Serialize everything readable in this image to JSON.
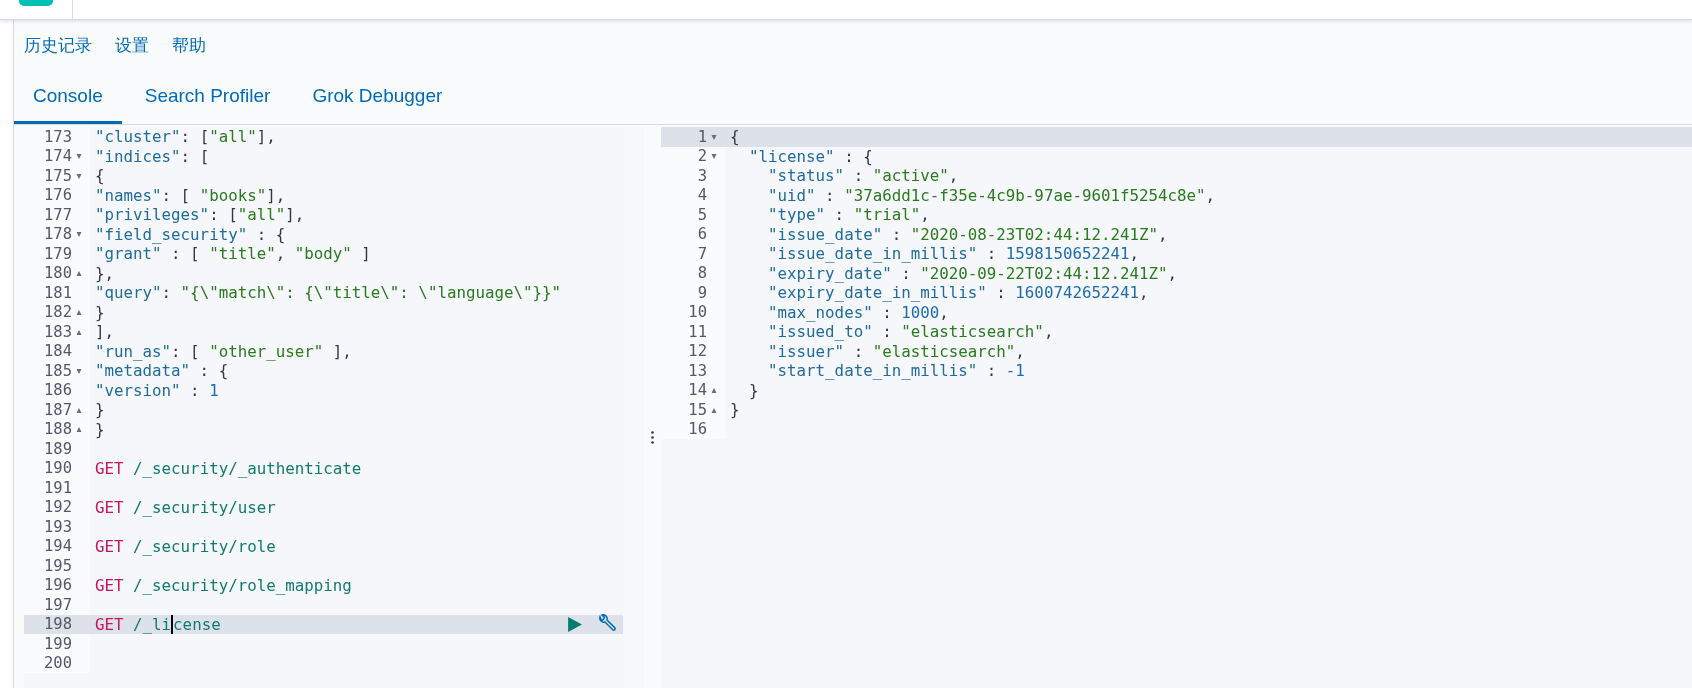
{
  "top_menu": [
    {
      "label": "历史记录"
    },
    {
      "label": "设置"
    },
    {
      "label": "帮助"
    }
  ],
  "tabs": [
    {
      "label": "Console",
      "selected": true
    },
    {
      "label": "Search Profiler",
      "selected": false
    },
    {
      "label": "Grok Debugger",
      "selected": false
    }
  ],
  "request_editor": {
    "lines": [
      {
        "number": "173",
        "selected": false,
        "tokens": [
          {
            "kind": "key",
            "text": "\"cluster\""
          },
          {
            "kind": "punct",
            "text": ": ["
          },
          {
            "kind": "string",
            "text": "\"all\""
          },
          {
            "kind": "punct",
            "text": "],"
          }
        ]
      },
      {
        "number": "174",
        "fold": "▾",
        "selected": false,
        "tokens": [
          {
            "kind": "key",
            "text": "\"indices\""
          },
          {
            "kind": "punct",
            "text": ": ["
          }
        ]
      },
      {
        "number": "175",
        "fold": "▾",
        "selected": false,
        "tokens": [
          {
            "kind": "punct",
            "text": "{"
          }
        ]
      },
      {
        "number": "176",
        "selected": false,
        "tokens": [
          {
            "kind": "key",
            "text": "\"names\""
          },
          {
            "kind": "punct",
            "text": ": [ "
          },
          {
            "kind": "string",
            "text": "\"books\""
          },
          {
            "kind": "punct",
            "text": "],"
          }
        ]
      },
      {
        "number": "177",
        "selected": false,
        "tokens": [
          {
            "kind": "key",
            "text": "\"privileges\""
          },
          {
            "kind": "punct",
            "text": ": ["
          },
          {
            "kind": "string",
            "text": "\"all\""
          },
          {
            "kind": "punct",
            "text": "],"
          }
        ]
      },
      {
        "number": "178",
        "fold": "▾",
        "selected": false,
        "tokens": [
          {
            "kind": "key",
            "text": "\"field_security\""
          },
          {
            "kind": "punct",
            "text": " : {"
          }
        ]
      },
      {
        "number": "179",
        "selected": false,
        "tokens": [
          {
            "kind": "key",
            "text": "\"grant\""
          },
          {
            "kind": "punct",
            "text": " : [ "
          },
          {
            "kind": "string",
            "text": "\"title\""
          },
          {
            "kind": "punct",
            "text": ", "
          },
          {
            "kind": "string",
            "text": "\"body\""
          },
          {
            "kind": "punct",
            "text": " ]"
          }
        ]
      },
      {
        "number": "180",
        "fold": "▴",
        "selected": false,
        "tokens": [
          {
            "kind": "punct",
            "text": "},"
          }
        ]
      },
      {
        "number": "181",
        "selected": false,
        "tokens": [
          {
            "kind": "key",
            "text": "\"query\""
          },
          {
            "kind": "punct",
            "text": ": "
          },
          {
            "kind": "string",
            "text": "\"{\\\"match\\\": {\\\"title\\\": \\\"language\\\"}}\""
          }
        ]
      },
      {
        "number": "182",
        "fold": "▴",
        "selected": false,
        "tokens": [
          {
            "kind": "punct",
            "text": "}"
          }
        ]
      },
      {
        "number": "183",
        "fold": "▴",
        "selected": false,
        "tokens": [
          {
            "kind": "punct",
            "text": "],"
          }
        ]
      },
      {
        "number": "184",
        "selected": false,
        "tokens": [
          {
            "kind": "key",
            "text": "\"run_as\""
          },
          {
            "kind": "punct",
            "text": ": [ "
          },
          {
            "kind": "string",
            "text": "\"other_user\""
          },
          {
            "kind": "punct",
            "text": " ],"
          }
        ]
      },
      {
        "number": "185",
        "fold": "▾",
        "selected": false,
        "tokens": [
          {
            "kind": "key",
            "text": "\"metadata\""
          },
          {
            "kind": "punct",
            "text": " : {"
          }
        ]
      },
      {
        "number": "186",
        "selected": false,
        "tokens": [
          {
            "kind": "key",
            "text": "\"version\""
          },
          {
            "kind": "punct",
            "text": " : "
          },
          {
            "kind": "number",
            "text": "1"
          }
        ]
      },
      {
        "number": "187",
        "fold": "▴",
        "selected": false,
        "tokens": [
          {
            "kind": "punct",
            "text": "}"
          }
        ]
      },
      {
        "number": "188",
        "fold": "▴",
        "selected": false,
        "tokens": [
          {
            "kind": "punct",
            "text": "}"
          }
        ]
      },
      {
        "number": "189",
        "selected": false
      },
      {
        "number": "190",
        "selected": false,
        "tokens": [
          {
            "kind": "method",
            "text": "GET"
          },
          {
            "kind": "url",
            "text": " /_security/_authenticate"
          }
        ]
      },
      {
        "number": "191",
        "selected": false
      },
      {
        "number": "192",
        "selected": false,
        "tokens": [
          {
            "kind": "method",
            "text": "GET"
          },
          {
            "kind": "url",
            "text": " /_security/user"
          }
        ]
      },
      {
        "number": "193",
        "selected": false
      },
      {
        "number": "194",
        "selected": false,
        "tokens": [
          {
            "kind": "method",
            "text": "GET"
          },
          {
            "kind": "url",
            "text": " /_security/role"
          }
        ]
      },
      {
        "number": "195",
        "selected": false
      },
      {
        "number": "196",
        "selected": false,
        "tokens": [
          {
            "kind": "method",
            "text": "GET"
          },
          {
            "kind": "url",
            "text": " /_security/role_mapping"
          }
        ]
      },
      {
        "number": "197",
        "selected": false
      },
      {
        "number": "198",
        "selected": true,
        "tokens": [
          {
            "kind": "method",
            "text": "GET"
          },
          {
            "kind": "url",
            "text": " /_li"
          },
          {
            "kind": "url",
            "text": "cense",
            "caret_before": true
          }
        ]
      },
      {
        "number": "199",
        "selected": false
      },
      {
        "number": "200",
        "selected": false
      }
    ]
  },
  "response_viewer": {
    "lines": [
      {
        "number": "1",
        "fold": "▾",
        "selected": true,
        "tokens": [
          {
            "kind": "punct",
            "text": "{"
          }
        ]
      },
      {
        "number": "2",
        "fold": "▾",
        "selected": false,
        "tokens": [
          {
            "kind": "key",
            "text": "  \"license\""
          },
          {
            "kind": "punct",
            "text": " : {"
          }
        ]
      },
      {
        "number": "3",
        "selected": false,
        "tokens": [
          {
            "kind": "key",
            "text": "    \"status\""
          },
          {
            "kind": "punct",
            "text": " : "
          },
          {
            "kind": "string",
            "text": "\"active\""
          },
          {
            "kind": "punct",
            "text": ","
          }
        ]
      },
      {
        "number": "4",
        "selected": false,
        "tokens": [
          {
            "kind": "key",
            "text": "    \"uid\""
          },
          {
            "kind": "punct",
            "text": " : "
          },
          {
            "kind": "string",
            "text": "\"37a6dd1c-f35e-4c9b-97ae-9601f5254c8e\""
          },
          {
            "kind": "punct",
            "text": ","
          }
        ]
      },
      {
        "number": "5",
        "selected": false,
        "tokens": [
          {
            "kind": "key",
            "text": "    \"type\""
          },
          {
            "kind": "punct",
            "text": " : "
          },
          {
            "kind": "string",
            "text": "\"trial\""
          },
          {
            "kind": "punct",
            "text": ","
          }
        ]
      },
      {
        "number": "6",
        "selected": false,
        "tokens": [
          {
            "kind": "key",
            "text": "    \"issue_date\""
          },
          {
            "kind": "punct",
            "text": " : "
          },
          {
            "kind": "string",
            "text": "\"2020-08-23T02:44:12.241Z\""
          },
          {
            "kind": "punct",
            "text": ","
          }
        ]
      },
      {
        "number": "7",
        "selected": false,
        "tokens": [
          {
            "kind": "key",
            "text": "    \"issue_date_in_millis\""
          },
          {
            "kind": "punct",
            "text": " : "
          },
          {
            "kind": "number",
            "text": "1598150652241"
          },
          {
            "kind": "punct",
            "text": ","
          }
        ]
      },
      {
        "number": "8",
        "selected": false,
        "tokens": [
          {
            "kind": "key",
            "text": "    \"expiry_date\""
          },
          {
            "kind": "punct",
            "text": " : "
          },
          {
            "kind": "string",
            "text": "\"2020-09-22T02:44:12.241Z\""
          },
          {
            "kind": "punct",
            "text": ","
          }
        ]
      },
      {
        "number": "9",
        "selected": false,
        "tokens": [
          {
            "kind": "key",
            "text": "    \"expiry_date_in_millis\""
          },
          {
            "kind": "punct",
            "text": " : "
          },
          {
            "kind": "number",
            "text": "1600742652241"
          },
          {
            "kind": "punct",
            "text": ","
          }
        ]
      },
      {
        "number": "10",
        "selected": false,
        "tokens": [
          {
            "kind": "key",
            "text": "    \"max_nodes\""
          },
          {
            "kind": "punct",
            "text": " : "
          },
          {
            "kind": "number",
            "text": "1000"
          },
          {
            "kind": "punct",
            "text": ","
          }
        ]
      },
      {
        "number": "11",
        "selected": false,
        "tokens": [
          {
            "kind": "key",
            "text": "    \"issued_to\""
          },
          {
            "kind": "punct",
            "text": " : "
          },
          {
            "kind": "string",
            "text": "\"elasticsearch\""
          },
          {
            "kind": "punct",
            "text": ","
          }
        ]
      },
      {
        "number": "12",
        "selected": false,
        "tokens": [
          {
            "kind": "key",
            "text": "    \"issuer\""
          },
          {
            "kind": "punct",
            "text": " : "
          },
          {
            "kind": "string",
            "text": "\"elasticsearch\""
          },
          {
            "kind": "punct",
            "text": ","
          }
        ]
      },
      {
        "number": "13",
        "selected": false,
        "tokens": [
          {
            "kind": "key",
            "text": "    \"start_date_in_millis\""
          },
          {
            "kind": "punct",
            "text": " : "
          },
          {
            "kind": "number",
            "text": "-1"
          }
        ]
      },
      {
        "number": "14",
        "fold": "▴",
        "selected": false,
        "tokens": [
          {
            "kind": "punct",
            "text": "  }"
          }
        ]
      },
      {
        "number": "15",
        "fold": "▴",
        "selected": false,
        "tokens": [
          {
            "kind": "punct",
            "text": "}"
          }
        ]
      },
      {
        "number": "16",
        "selected": false
      }
    ]
  }
}
